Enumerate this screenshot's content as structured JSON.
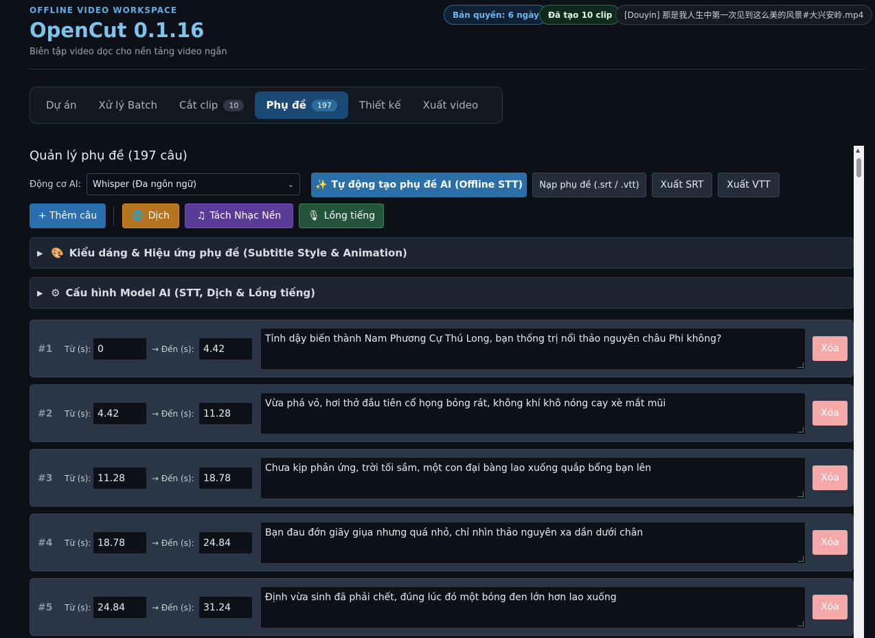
{
  "header": {
    "eyebrow": "OFFLINE VIDEO WORKSPACE",
    "title": "OpenCut 0.1.16",
    "subtitle": "Biên tập video dọc cho nền tảng video ngắn",
    "license_pill": "Bản quyền: 6 ngày",
    "trained_pill": "Đã tạo 10 clip",
    "file_pill": "[Douyin] 那是我人生中第一次见到这么美的风景#大兴安岭.mp4"
  },
  "tabs": [
    {
      "label": "Dự án",
      "badge": ""
    },
    {
      "label": "Xử lý Batch",
      "badge": ""
    },
    {
      "label": "Cắt clip",
      "badge": "10"
    },
    {
      "label": "Phụ đề",
      "badge": "197",
      "active": true
    },
    {
      "label": "Thiết kế",
      "badge": ""
    },
    {
      "label": "Xuất video",
      "badge": ""
    }
  ],
  "section": {
    "title": "Quản lý phụ đề (197 câu)",
    "engine_label": "Động cơ AI:",
    "engine_value": "Whisper (Đa ngôn ngữ)"
  },
  "toolbar": {
    "ai_button": "Tự động tạo phụ đề AI (Offline STT)",
    "load_button": "Nạp phụ đề (.srt / .vtt)",
    "export_srt": "Xuất SRT",
    "export_vtt": "Xuất VTT",
    "add_button": "+ Thêm câu",
    "translate_button": "Dịch",
    "music_button": "Tách Nhạc Nền",
    "dub_button": "Lồng tiếng"
  },
  "panels": {
    "style": "Kiểu dáng & Hiệu ứng phụ đề (Subtitle Style & Animation)",
    "model": "Cấu hình Model AI (STT, Dịch & Lồng tiếng)"
  },
  "row_labels": {
    "from": "Từ (s):",
    "to": "→ Đến (s):",
    "delete": "Xóa"
  },
  "subtitles": [
    {
      "index": "#1",
      "from": "0",
      "to": "4.42",
      "text": "Tỉnh dậy biến thành Nam Phương Cự Thú Long, bạn thống trị nổi thảo nguyên châu Phi không?"
    },
    {
      "index": "#2",
      "from": "4.42",
      "to": "11.28",
      "text": "Vừa phá vỏ, hơi thở đầu tiên cổ họng bỏng rát, không khí khô nóng cay xè mắt mũi"
    },
    {
      "index": "#3",
      "from": "11.28",
      "to": "18.78",
      "text": "Chưa kịp phản ứng, trời tối sầm, một con đại bàng lao xuống quắp bổng bạn lên"
    },
    {
      "index": "#4",
      "from": "18.78",
      "to": "24.84",
      "text": "Bạn đau đớn giãy giụa nhưng quá nhỏ, chỉ nhìn thảo nguyên xa dần dưới chân"
    },
    {
      "index": "#5",
      "from": "24.84",
      "to": "31.24",
      "text": "Định vừa sinh đã phải chết, đúng lúc đó một bóng đen lớn hơn lao xuống"
    }
  ]
}
